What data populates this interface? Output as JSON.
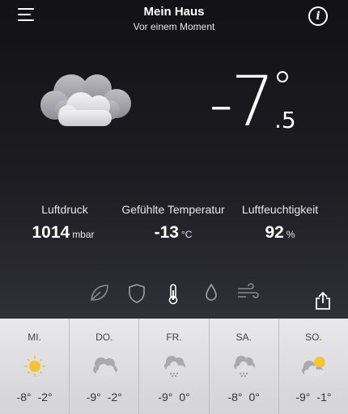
{
  "header": {
    "title": "Mein Haus",
    "subtitle": "Vor einem Moment"
  },
  "current": {
    "condition_icon": "cloud-icon",
    "sign": "-",
    "temp_int": "7",
    "temp_dec": ".5"
  },
  "stats": {
    "pressure": {
      "label": "Luftdruck",
      "value": "1014",
      "unit": "mbar"
    },
    "feels_like": {
      "label": "Gefühlte Temperatur",
      "value": "-13",
      "unit": "°C"
    },
    "humidity": {
      "label": "Luftfeuchtigkeit",
      "value": "92",
      "unit": "%"
    }
  },
  "tabs": [
    "leaf-icon",
    "shield-icon",
    "thermometer-icon",
    "droplet-icon",
    "wind-icon"
  ],
  "forecast": [
    {
      "day": "MI.",
      "icon": "sun-icon",
      "low": "-8°",
      "high": "-2°"
    },
    {
      "day": "DO.",
      "icon": "cloud-icon",
      "low": "-9°",
      "high": "-2°"
    },
    {
      "day": "FR.",
      "icon": "snow-cloud-icon",
      "low": "-9°",
      "high": "0°"
    },
    {
      "day": "SA.",
      "icon": "snow-cloud-icon",
      "low": "-8°",
      "high": "0°"
    },
    {
      "day": "SO.",
      "icon": "partly-cloudy-icon",
      "low": "-9°",
      "high": "-1°"
    }
  ]
}
